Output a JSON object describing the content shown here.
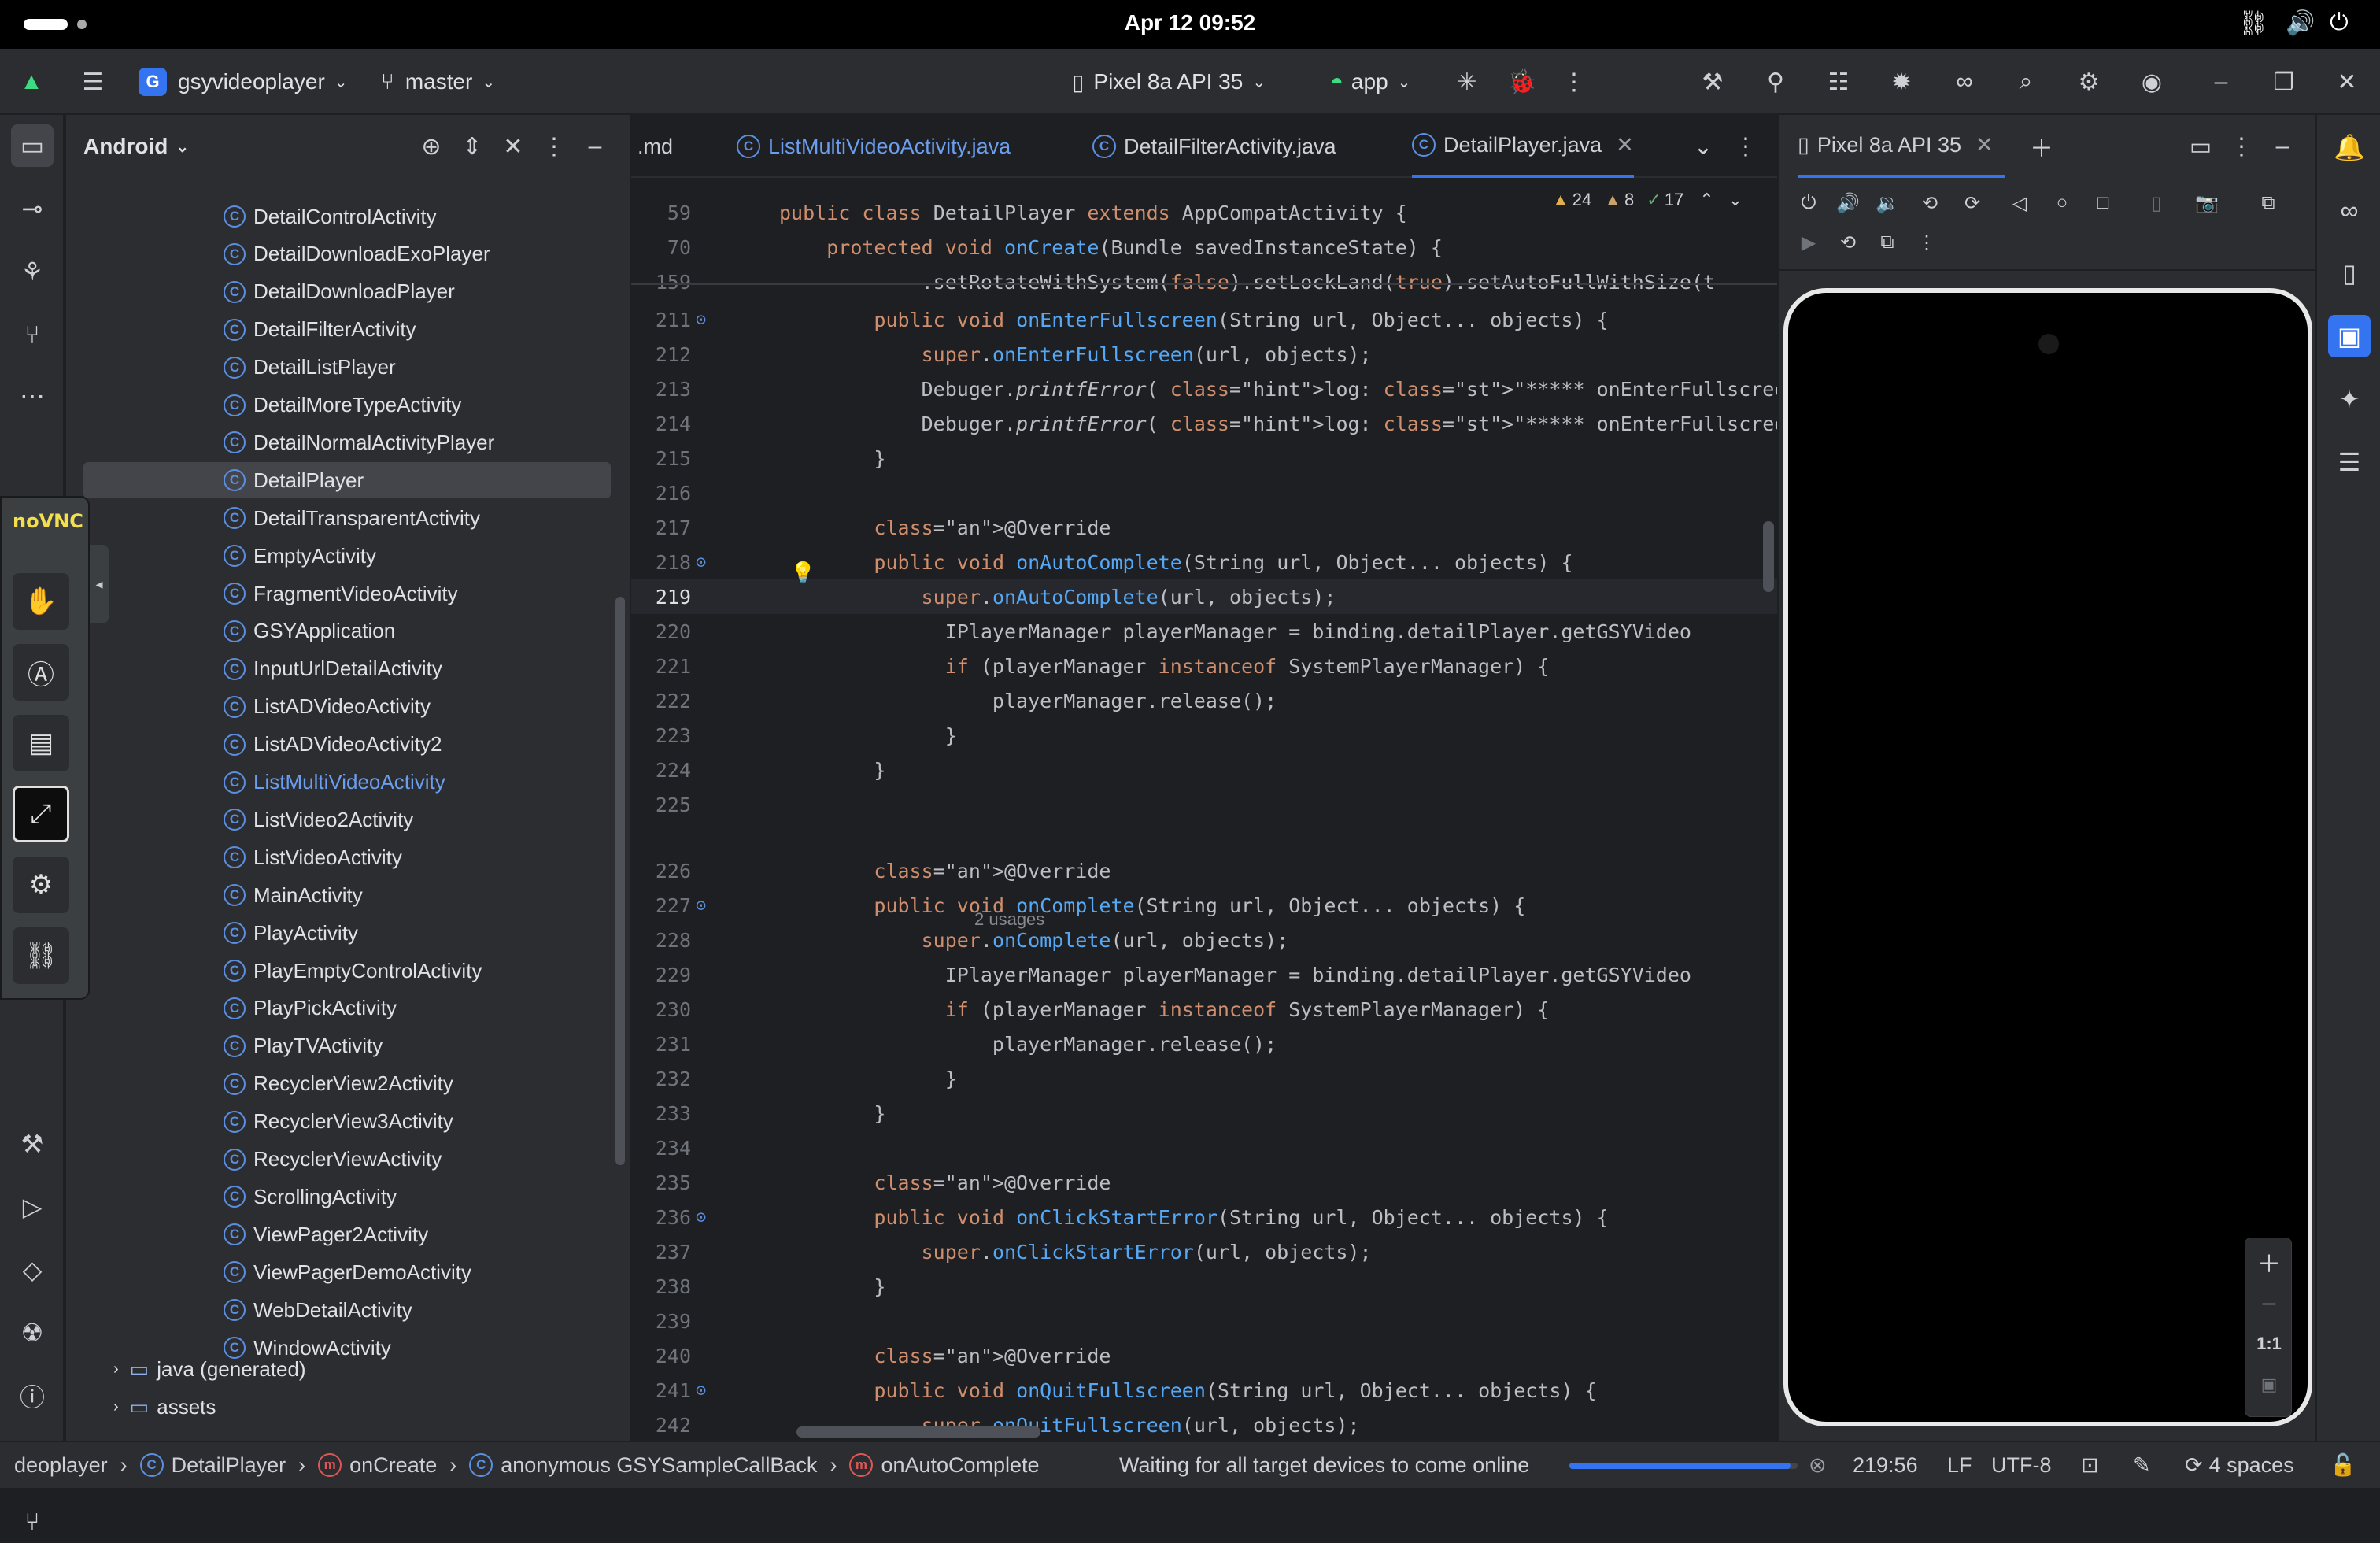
{
  "os": {
    "clock": "Apr 12  09:52"
  },
  "toolbar": {
    "project_badge": "G",
    "project_name": "gsyvideoplayer",
    "branch": "master",
    "device": "Pixel 8a API 35",
    "run_config": "app"
  },
  "project_panel": {
    "view_mode": "Android",
    "items": [
      "DetailControlActivity",
      "DetailDownloadExoPlayer",
      "DetailDownloadPlayer",
      "DetailFilterActivity",
      "DetailListPlayer",
      "DetailMoreTypeActivity",
      "DetailNormalActivityPlayer",
      "DetailPlayer",
      "DetailTransparentActivity",
      "EmptyActivity",
      "FragmentVideoActivity",
      "GSYApplication",
      "InputUrlDetailActivity",
      "ListADVideoActivity",
      "ListADVideoActivity2",
      "ListMultiVideoActivity",
      "ListVideo2Activity",
      "ListVideoActivity",
      "MainActivity",
      "PlayActivity",
      "PlayEmptyControlActivity",
      "PlayPickActivity",
      "PlayTVActivity",
      "RecyclerView2Activity",
      "RecyclerView3Activity",
      "RecyclerViewActivity",
      "ScrollingActivity",
      "ViewPager2Activity",
      "ViewPagerDemoActivity",
      "WebDetailActivity",
      "WindowActivity"
    ],
    "selected": "DetailPlayer",
    "highlighted": "ListMultiVideoActivity",
    "folders": [
      "java (generated)",
      "assets"
    ]
  },
  "vnc": {
    "logo": "noVNC"
  },
  "editor": {
    "tabs": [
      ".md",
      "ListMultiVideoActivity.java",
      "DetailFilterActivity.java",
      "DetailPlayer.java"
    ],
    "active_tab": "DetailPlayer.java",
    "inspections": {
      "warnings": "24",
      "weak": "8",
      "typos": "17"
    },
    "usages": "2 usages",
    "lines": [
      {
        "n": "59",
        "t": "public class DetailPlayer extends AppCompatActivity {"
      },
      {
        "n": "70",
        "t": "    protected void onCreate(Bundle savedInstanceState) {"
      },
      {
        "n": "159",
        "t": "            .setRotateWithSystem(false).setLockLand(true).setAutoFullWithSize(t"
      },
      {
        "n": "211",
        "t": "        public void onEnterFullscreen(String url, Object... objects) {"
      },
      {
        "n": "212",
        "t": "            super.onEnterFullscreen(url, objects);"
      },
      {
        "n": "213",
        "t": "            Debuger.printfError( log: \"***** onEnterFullscreen **** \" + objects"
      },
      {
        "n": "214",
        "t": "            Debuger.printfError( log: \"***** onEnterFullscreen **** \" + objects"
      },
      {
        "n": "215",
        "t": "        }"
      },
      {
        "n": "216",
        "t": ""
      },
      {
        "n": "217",
        "t": "        @Override"
      },
      {
        "n": "218",
        "t": "        public void onAutoComplete(String url, Object... objects) {"
      },
      {
        "n": "219",
        "t": "            super.onAutoComplete(url, objects);"
      },
      {
        "n": "220",
        "t": "              IPlayerManager playerManager = binding.detailPlayer.getGSYVideo"
      },
      {
        "n": "221",
        "t": "              if (playerManager instanceof SystemPlayerManager) {"
      },
      {
        "n": "222",
        "t": "                  playerManager.release();"
      },
      {
        "n": "223",
        "t": "              }"
      },
      {
        "n": "224",
        "t": "        }"
      },
      {
        "n": "225",
        "t": ""
      },
      {
        "n": "226",
        "t": "        @Override"
      },
      {
        "n": "227",
        "t": "        public void onComplete(String url, Object... objects) {"
      },
      {
        "n": "228",
        "t": "            super.onComplete(url, objects);"
      },
      {
        "n": "229",
        "t": "              IPlayerManager playerManager = binding.detailPlayer.getGSYVideo"
      },
      {
        "n": "230",
        "t": "              if (playerManager instanceof SystemPlayerManager) {"
      },
      {
        "n": "231",
        "t": "                  playerManager.release();"
      },
      {
        "n": "232",
        "t": "              }"
      },
      {
        "n": "233",
        "t": "        }"
      },
      {
        "n": "234",
        "t": ""
      },
      {
        "n": "235",
        "t": "        @Override"
      },
      {
        "n": "236",
        "t": "        public void onClickStartError(String url, Object... objects) {"
      },
      {
        "n": "237",
        "t": "            super.onClickStartError(url, objects);"
      },
      {
        "n": "238",
        "t": "        }"
      },
      {
        "n": "239",
        "t": ""
      },
      {
        "n": "240",
        "t": "        @Override"
      },
      {
        "n": "241",
        "t": "        public void onQuitFullscreen(String url, Object... objects) {"
      },
      {
        "n": "242",
        "t": "            super.onQuitFullscreen(url, objects);"
      }
    ]
  },
  "emulator": {
    "tab": "Pixel 8a API 35",
    "zoom_ratio": "1:1"
  },
  "statusbar": {
    "crumbs": [
      "deoplayer",
      "DetailPlayer",
      "onCreate",
      "anonymous GSYSampleCallBack",
      "onAutoComplete"
    ],
    "message": "Waiting for all target devices to come online",
    "progress": 0.97,
    "position": "219:56",
    "line_sep": "LF",
    "encoding": "UTF-8",
    "indent": "4 spaces"
  }
}
